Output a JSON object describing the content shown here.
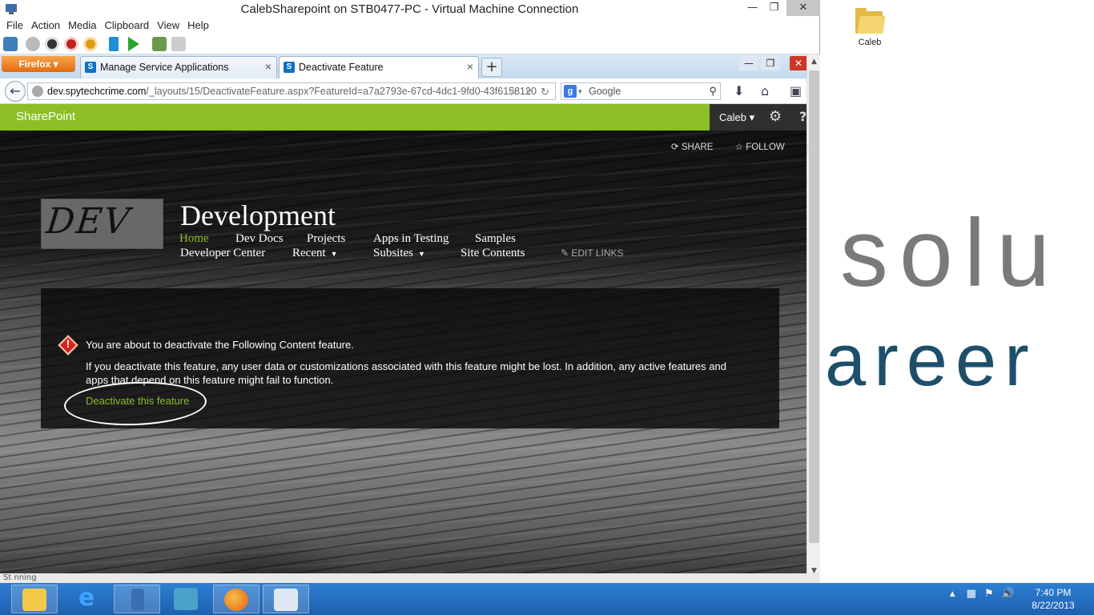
{
  "vm_window": {
    "title": "CalebSharepoint on STB0477-PC - Virtual Machine Connection",
    "menu": [
      "File",
      "Action",
      "Media",
      "Clipboard",
      "View",
      "Help"
    ]
  },
  "browser": {
    "app_button": "Firefox",
    "tabs": [
      {
        "label": "Manage Service Applications",
        "active": false
      },
      {
        "label": "Deactivate Feature",
        "active": true
      }
    ],
    "url_domain": "dev.spytechcrime.com",
    "url_path": "/_layouts/15/DeactivateFeature.aspx?FeatureId=a7a2793e-67cd-4dc1-9fd0-43f6158120",
    "search_placeholder": "Google",
    "search_engine_letter": "g"
  },
  "sharepoint": {
    "brand": "SharePoint",
    "user": "Caleb",
    "share": "SHARE",
    "follow": "FOLLOW",
    "logo_text": "DEV",
    "site_title": "Development",
    "nav": {
      "home": "Home",
      "dev_docs": "Dev Docs",
      "projects": "Projects",
      "apps_in_testing": "Apps in Testing",
      "samples": "Samples",
      "developer_center": "Developer Center",
      "recent": "Recent",
      "subsites": "Subsites",
      "site_contents": "Site Contents",
      "edit_links": "EDIT LINKS"
    },
    "message": {
      "line1": "You are about to deactivate the Following Content feature.",
      "line2a": "If you deactivate this feature, any user data or customizations associated with this feature might be lost. In addition, any active features and",
      "line2b": "apps that depend on this feature might fail to function.",
      "link": "Deactivate this feature"
    },
    "colors": {
      "accent": "#8cbf26"
    }
  },
  "desktop": {
    "icon_label": "Caleb",
    "wallpaper_text_1": "solu",
    "wallpaper_text_2": "areer"
  },
  "statusbar": {
    "text": "St       nning"
  },
  "taskbar": {
    "apps": [
      "file-explorer-icon",
      "internet-explorer-icon",
      "server-manager-icon",
      "hyper-v-icon",
      "firefox-icon",
      "vm-connection-icon"
    ],
    "time": "7:40 PM",
    "date": "8/22/2013"
  }
}
